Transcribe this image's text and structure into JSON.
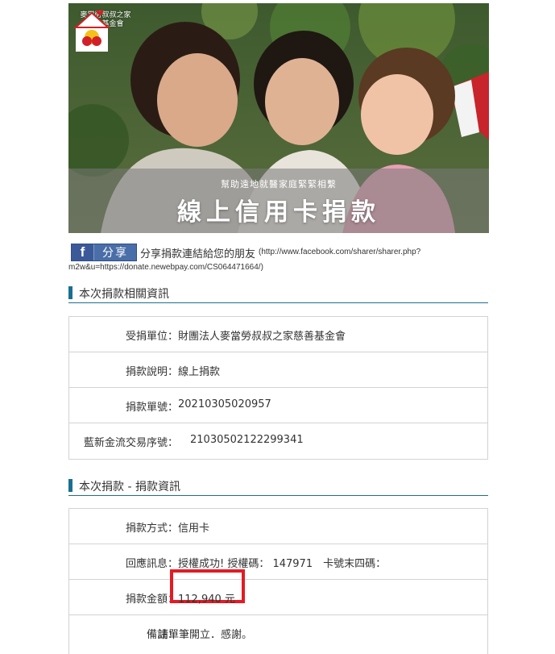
{
  "banner": {
    "logo_line1": "麥當勞叔叔之家",
    "logo_line2": "慈善基金會",
    "subtitle": "幫助遠地就醫家庭緊緊相繫",
    "title": "線上信用卡捐款"
  },
  "share": {
    "fb_glyph": "f",
    "button_label": "分享",
    "text": "分享捐款連結給您的朋友",
    "url_part1": "(http://www.facebook.com/sharer/sharer.php?",
    "url_part2": "m2w&u=https://donate.newebpay.com/CS064471664/)"
  },
  "donation_info": {
    "title": "本次捐款相關資訊",
    "rows": [
      {
        "label": "受捐單位：",
        "value": "財團法人麥當勞叔叔之家慈善基金會"
      },
      {
        "label": "捐款說明：",
        "value": "線上捐款"
      },
      {
        "label": "捐款單號：",
        "value": "20210305020957"
      },
      {
        "label": "藍新金流交易序號：",
        "value": "21030502122299341"
      }
    ]
  },
  "payment_info": {
    "title": "本次捐款 - 捐款資訊",
    "rows": [
      {
        "label": "捐款方式：",
        "value": "信用卡"
      },
      {
        "label": "回應訊息：",
        "value": "授權成功! 授權碼： 147971　卡號末四碼："
      },
      {
        "label": "捐款金額：",
        "value": "112,940 元"
      },
      {
        "label": "備註：",
        "value": "請單筆開立．感謝。"
      }
    ]
  },
  "colors": {
    "accent": "#1b6f91",
    "highlight": "#e31b23",
    "facebook": "#3b5998"
  }
}
